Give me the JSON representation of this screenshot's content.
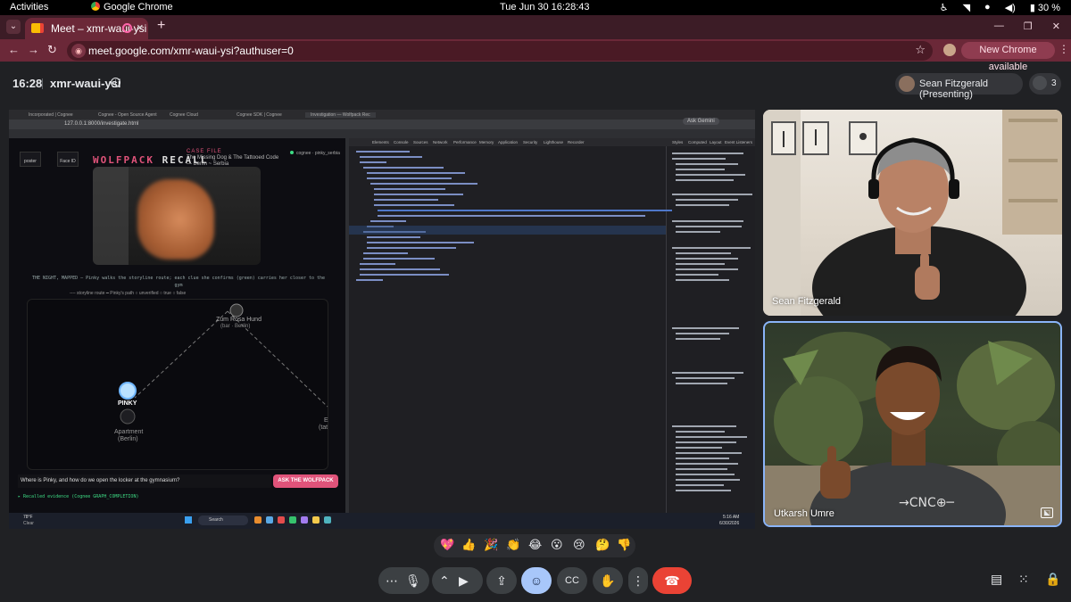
{
  "gnome": {
    "activities": "Activities",
    "app_name": "Google Chrome",
    "clock": "Tue Jun 30  16:28:43",
    "battery": "30 %"
  },
  "browser": {
    "tab_title": "Meet – xmr-waui-ysi",
    "url": "meet.google.com/xmr-waui-ysi?authuser=0",
    "new_chrome_label": "New Chrome available"
  },
  "meet": {
    "time": "16:28",
    "code": "xmr-waui-ysi",
    "presenter_chip": "Sean Fitzgerald (Presenting)",
    "participant_count": "3",
    "participants": [
      {
        "name": "Sean Fitzgerald"
      },
      {
        "name": "Utkarsh Umre"
      }
    ],
    "reactions": [
      "💖",
      "👍",
      "🎉",
      "👏",
      "😂",
      "😮",
      "😢",
      "🤔",
      "👎"
    ]
  },
  "shared_screen": {
    "browser_tabs": [
      "Incorporated | Cognee",
      "Cognee - Open Source Agent",
      "Cognee Cloud",
      "Cognee SDK | Cognee",
      "Investigation — Wolfpack Rec"
    ],
    "address": "127.0.0.1:8000/investigate.html",
    "ask_gemini": "Ask Gemini",
    "app": {
      "tab_poster": "poster",
      "tab_faceid": "Face ID",
      "title_left": "WOLFPACK",
      "title_right": "RECALL",
      "case_label": "CASE FILE",
      "case_title": "The Missing Dog & The Tattooed Code — Berlin ~ Serbia",
      "cognee_tag": "cognee · pinky_serbia",
      "night_mapped": "THE NIGHT, MAPPED — Pinky walks the storyline route; each clue she confirms (green) carries her closer to the gym",
      "legend": "---- storyline route   ━ Pinky's path   ○ unverified   ○ true   ○ false",
      "nodes": {
        "zum_rosa": "Zum Rosa Hund",
        "zum_rosa_sub": "(bar · Berlin)",
        "pinky": "PINKY",
        "apartment": "Apartment",
        "apartment_sub": "(Berlin)",
        "edge_e": "E",
        "edge_tat": "(tat"
      },
      "question": "Where is Pinky, and how do we open the locker at the gymnasium?",
      "ask_button": "ASK THE WOLFPACK",
      "recalled": "▸ Recalled evidence (Cognee GRAPH_COMPLETION)"
    },
    "devtools_tabs": [
      "Elements",
      "Console",
      "Sources",
      "Network",
      "Performance",
      "Memory",
      "Application",
      "Security",
      "Lighthouse",
      "Recorder"
    ],
    "devtools_side_tabs": [
      "Styles",
      "Computed",
      "Layout",
      "Event Listeners"
    ],
    "taskbar": {
      "weather_temp": "78°F",
      "weather_desc": "Clear",
      "search": "Search",
      "time": "5:16 AM",
      "date": "6/30/2026"
    }
  },
  "colors": {
    "accent_pink": "#e0537a",
    "hangup_red": "#ea4335",
    "active_speaker_blue": "#8ab4f8"
  }
}
